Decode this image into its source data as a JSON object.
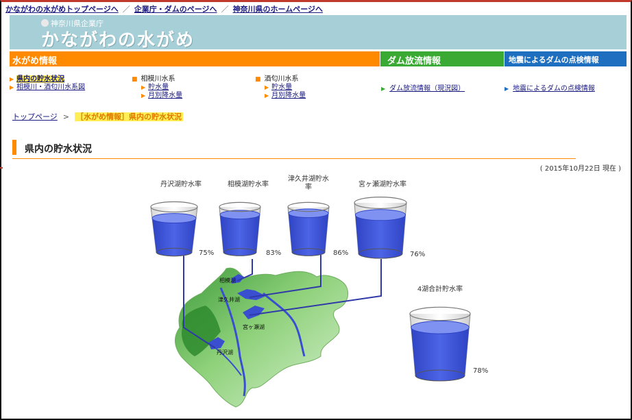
{
  "top_links": [
    "かながわの水がめトップページへ",
    "企業庁・ダムのページへ",
    "神奈川県のホームページへ"
  ],
  "top_links_sep": "／",
  "banner": {
    "org": "神奈川県企業庁",
    "title": "かながわの水がめ"
  },
  "nav": {
    "water": "水がめ情報",
    "dam": "ダム放流情報",
    "quake": "地震によるダムの点検情報"
  },
  "submenu": {
    "col1": [
      "県内の貯水状況",
      "相模川・酒匂川水系図"
    ],
    "col2_head": "相模川水系",
    "col2": [
      "貯水量",
      "月別降水量"
    ],
    "col3_head": "酒匂川水系",
    "col3": [
      "貯水量",
      "月別降水量"
    ],
    "col4": "ダム放流情報（現況図）",
    "col5": "地震によるダムの点検情報"
  },
  "breadcrumb": {
    "home": "トップページ",
    "sep": ">",
    "current": "［水がめ情報］県内の貯水状況"
  },
  "section_title": "県内の貯水状況",
  "date_text": "( 2015年10月22日 現在 )",
  "reservoirs": [
    {
      "label": "丹沢湖貯水率",
      "percent": "75%",
      "level": 0.75
    },
    {
      "label": "相模湖貯水率",
      "percent": "83%",
      "level": 0.83
    },
    {
      "label": "津久井湖貯水率",
      "percent": "86%",
      "level": 0.86
    },
    {
      "label": "宮ヶ瀬湖貯水率",
      "percent": "76%",
      "level": 0.76
    }
  ],
  "total": {
    "label": "4湖合計貯水率",
    "percent": "78%",
    "level": 0.78
  },
  "map_labels": {
    "sagami": "相模湖",
    "tsukui": "津久井湖",
    "miyagase": "宮ヶ瀬湖",
    "tanzawa": "丹沢湖"
  },
  "colors": {
    "orange": "#ff8a00",
    "green": "#3aaa35",
    "blue": "#1e6fbf",
    "water": "#3a4fd0",
    "banner": "#a6cfd8"
  }
}
